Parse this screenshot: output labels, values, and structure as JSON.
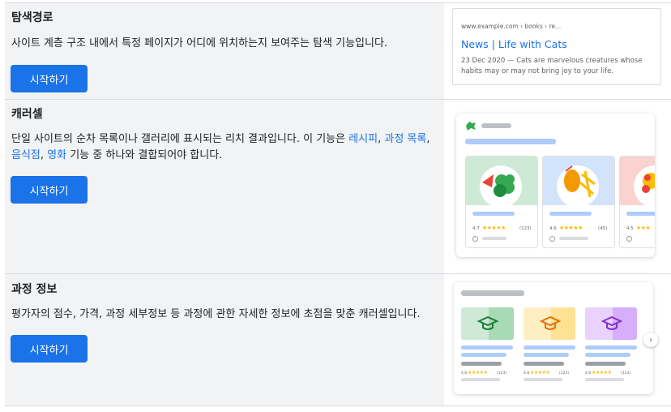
{
  "sections": [
    {
      "title": "탐색경로",
      "desc": "사이트 계층 구조 내에서 특정 페이지가 어디에 위치하는지 보여주는 탐색 기능입니다.",
      "button": "시작하기"
    },
    {
      "title": "캐러셀",
      "desc_parts": {
        "pre": "단일 사이트의 순차 목록이나 갤러리에 표시되는 리치 결과입니다. 이 기능은 ",
        "link1": "레시피",
        "sep1": ", ",
        "link2": "과정 목록",
        "sep2": ", ",
        "link3": "음식점",
        "sep3": ", ",
        "link4": "영화",
        "post": " 기능 중 하나와 결합되어야 합니다."
      },
      "button": "시작하기"
    },
    {
      "title": "과정 정보",
      "desc": "평가자의 점수, 가격, 과정 세부정보 등 과정에 관한 자세한 정보에 초점을 맞춘 캐러셀입니다.",
      "button": "시작하기"
    }
  ],
  "breadcrumb_preview": {
    "url": "www.example.com › books › re...",
    "title": "News | Life with Cats",
    "snippet": "23 Dec 2020 — Cats are marvelous creatures whose habits may or may not bring joy to your life."
  },
  "carousel_preview": {
    "items": [
      {
        "rating": "4.7",
        "stars": "★★★★★",
        "count": "(123)"
      },
      {
        "rating": "4.6",
        "stars": "★★★★★",
        "count": "(45)"
      },
      {
        "rating": "4.5",
        "stars": "★★★",
        "count": ""
      }
    ]
  },
  "course_preview": {
    "items": [
      {
        "rating": "4.8",
        "stars": "★★★★★",
        "count": "(123)"
      },
      {
        "rating": "4.8",
        "stars": "★★★★★",
        "count": "(123)"
      },
      {
        "rating": "4.8",
        "stars": "★★★★★",
        "count": "(123)"
      }
    ],
    "next_icon": "chevron-right-icon"
  },
  "colors": {
    "accent": "#1a73e8",
    "panel_bg": "#f1f3f4",
    "star": "#fbbc04"
  }
}
